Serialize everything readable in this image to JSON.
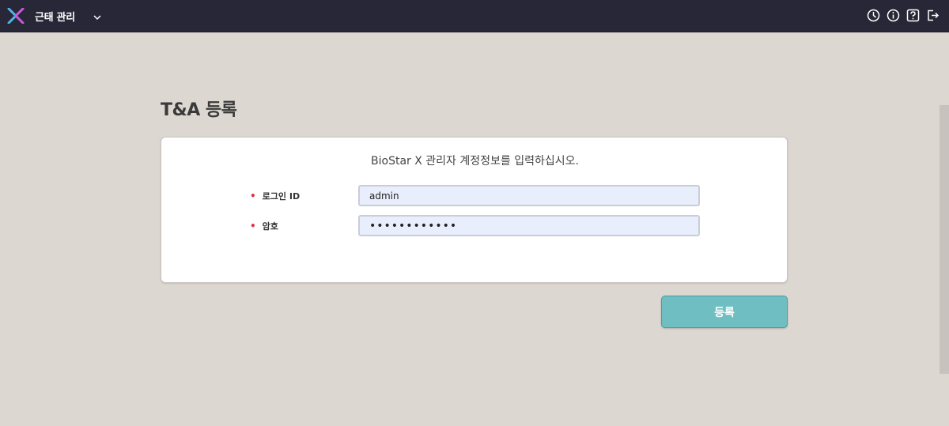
{
  "header": {
    "app_title": "근태 관리",
    "icons": [
      "clock-icon",
      "info-icon",
      "help-icon",
      "logout-icon"
    ]
  },
  "page": {
    "title": "T&A 등록"
  },
  "form": {
    "description": "BioStar X 관리자 계정정보를 입력하십시오.",
    "required_marker": "•",
    "login_label": "로그인 ID",
    "login_value": "admin",
    "password_label": "암호",
    "password_value": "••••••••••••"
  },
  "actions": {
    "submit_label": "등록"
  },
  "colors": {
    "topbar": "#272737",
    "background": "#ddd7d2",
    "accent": "#6fbfc2",
    "required": "#e0334a",
    "input_fill": "#e8eefc"
  }
}
